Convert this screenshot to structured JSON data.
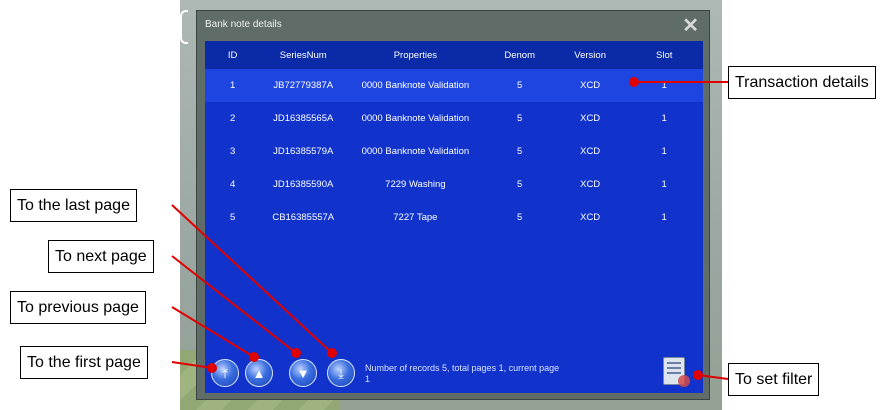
{
  "dialog": {
    "title": "Bank note details",
    "close_icon": "close-icon"
  },
  "table": {
    "headers": [
      "ID",
      "SeriesNum",
      "Properties",
      "Denom",
      "Version",
      "Slot"
    ],
    "rows": [
      [
        "1",
        "JB72779387A",
        "0000 Banknote Validation",
        "5",
        "XCD",
        "1"
      ],
      [
        "2",
        "JD16385565A",
        "0000 Banknote Validation",
        "5",
        "XCD",
        "1"
      ],
      [
        "3",
        "JD16385579A",
        "0000 Banknote Validation",
        "5",
        "XCD",
        "1"
      ],
      [
        "4",
        "JD16385590A",
        "7229 Washing",
        "5",
        "XCD",
        "1"
      ],
      [
        "5",
        "CB16385557A",
        "7227 Tape",
        "5",
        "XCD",
        "1"
      ]
    ]
  },
  "footer": {
    "status": "Number of records 5, total pages 1, current page 1",
    "first_icon": "first-page-icon",
    "prev_icon": "previous-page-icon",
    "next_icon": "next-page-icon",
    "last_icon": "last-page-icon",
    "filter_icon": "filter-icon"
  },
  "callouts": {
    "transaction_details": "Transaction details",
    "set_filter": "To set filter",
    "last_page": "To the last page",
    "next_page": "To next page",
    "previous_page": "To previous page",
    "first_page": "To the first page"
  },
  "colors": {
    "grid_bg": "#1133cc",
    "callout_line": "#e00000"
  }
}
